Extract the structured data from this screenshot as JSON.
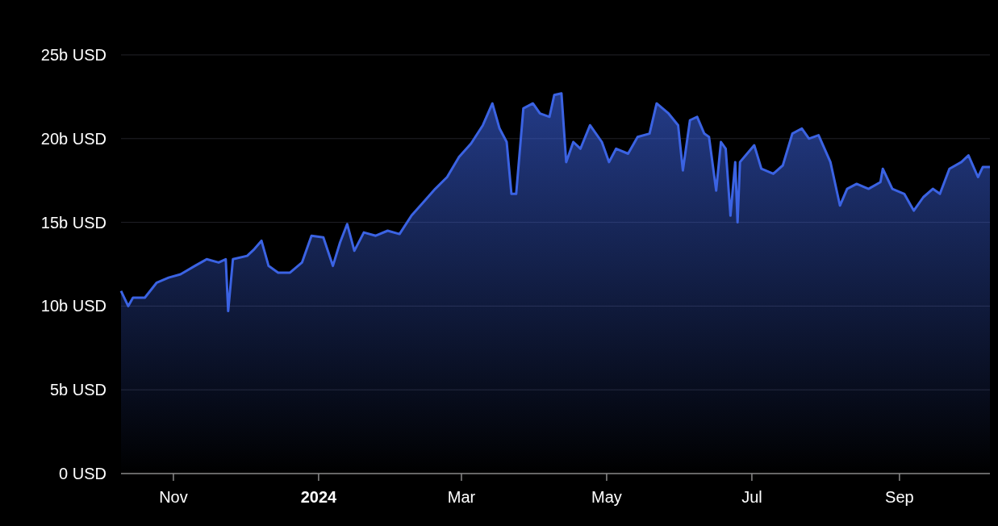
{
  "chart": {
    "chart_data": {
      "type": "area",
      "x": [
        "2023-10-10",
        "2023-10-13",
        "2023-10-15",
        "2023-10-20",
        "2023-10-25",
        "2023-10-30",
        "2023-11-04",
        "2023-11-10",
        "2023-11-15",
        "2023-11-20",
        "2023-11-23",
        "2023-11-24",
        "2023-11-26",
        "2023-12-02",
        "2023-12-05",
        "2023-12-08",
        "2023-12-11",
        "2023-12-15",
        "2023-12-20",
        "2023-12-25",
        "2023-12-29",
        "2024-01-03",
        "2024-01-07",
        "2024-01-10",
        "2024-01-13",
        "2024-01-16",
        "2024-01-20",
        "2024-01-25",
        "2024-01-30",
        "2024-02-04",
        "2024-02-09",
        "2024-02-14",
        "2024-02-19",
        "2024-02-24",
        "2024-02-29",
        "2024-03-05",
        "2024-03-10",
        "2024-03-14",
        "2024-03-17",
        "2024-03-20",
        "2024-03-22",
        "2024-03-24",
        "2024-03-27",
        "2024-03-31",
        "2024-04-03",
        "2024-04-07",
        "2024-04-09",
        "2024-04-12",
        "2024-04-14",
        "2024-04-17",
        "2024-04-20",
        "2024-04-24",
        "2024-04-29",
        "2024-05-02",
        "2024-05-05",
        "2024-05-10",
        "2024-05-14",
        "2024-05-19",
        "2024-05-22",
        "2024-05-27",
        "2024-05-31",
        "2024-06-02",
        "2024-06-05",
        "2024-06-08",
        "2024-06-11",
        "2024-06-13",
        "2024-06-16",
        "2024-06-18",
        "2024-06-20",
        "2024-06-22",
        "2024-06-24",
        "2024-06-25",
        "2024-06-26",
        "2024-06-29",
        "2024-07-02",
        "2024-07-05",
        "2024-07-10",
        "2024-07-14",
        "2024-07-18",
        "2024-07-22",
        "2024-07-25",
        "2024-07-29",
        "2024-08-03",
        "2024-08-07",
        "2024-08-10",
        "2024-08-14",
        "2024-08-19",
        "2024-08-24",
        "2024-08-25",
        "2024-08-29",
        "2024-09-03",
        "2024-09-07",
        "2024-09-11",
        "2024-09-15",
        "2024-09-18",
        "2024-09-22",
        "2024-09-27",
        "2024-09-30",
        "2024-10-04",
        "2024-10-06",
        "2024-10-09"
      ],
      "series": [
        {
          "color": "#3b63e3",
          "values": [
            10.9,
            10.0,
            10.5,
            10.5,
            11.4,
            11.7,
            11.9,
            12.4,
            12.8,
            12.6,
            12.8,
            9.7,
            12.8,
            13.0,
            13.4,
            13.9,
            12.4,
            12.0,
            12.0,
            12.6,
            14.2,
            14.1,
            12.4,
            13.8,
            14.9,
            13.3,
            14.4,
            14.2,
            14.5,
            14.3,
            15.4,
            16.2,
            17.0,
            17.7,
            18.9,
            19.7,
            20.8,
            22.1,
            20.6,
            19.8,
            16.7,
            16.7,
            21.8,
            22.1,
            21.5,
            21.3,
            22.6,
            22.7,
            18.6,
            19.8,
            19.4,
            20.8,
            19.8,
            18.6,
            19.4,
            19.1,
            20.1,
            20.3,
            22.1,
            21.5,
            20.8,
            18.1,
            21.1,
            21.3,
            20.3,
            20.1,
            16.9,
            19.8,
            19.4,
            15.4,
            18.6,
            15.0,
            18.6,
            19.1,
            19.6,
            18.2,
            17.9,
            18.4,
            20.3,
            20.6,
            20.0,
            20.2,
            18.6,
            16.0,
            17.0,
            17.3,
            17.0,
            17.4,
            18.2,
            17.0,
            16.7,
            15.7,
            16.5,
            17.0,
            16.7,
            18.2,
            18.6,
            19.0,
            17.7,
            18.3,
            18.3
          ]
        }
      ],
      "xlim": [
        "2023-10-10",
        "2024-10-09"
      ],
      "ylim": [
        0,
        25
      ],
      "grid": true,
      "xticks": [
        {
          "value": "2023-11-01",
          "label": "Nov"
        },
        {
          "value": "2024-01-01",
          "label": "2024"
        },
        {
          "value": "2024-03-01",
          "label": "Mar"
        },
        {
          "value": "2024-05-01",
          "label": "May"
        },
        {
          "value": "2024-07-01",
          "label": "Jul"
        },
        {
          "value": "2024-09-01",
          "label": "Sep"
        }
      ],
      "yticks": [
        {
          "value": 0,
          "label": "0 USD"
        },
        {
          "value": 5,
          "label": "5b USD"
        },
        {
          "value": 10,
          "label": "10b USD"
        },
        {
          "value": 15,
          "label": "15b USD"
        },
        {
          "value": 20,
          "label": "20b USD"
        },
        {
          "value": 25,
          "label": "25b USD"
        }
      ]
    }
  }
}
